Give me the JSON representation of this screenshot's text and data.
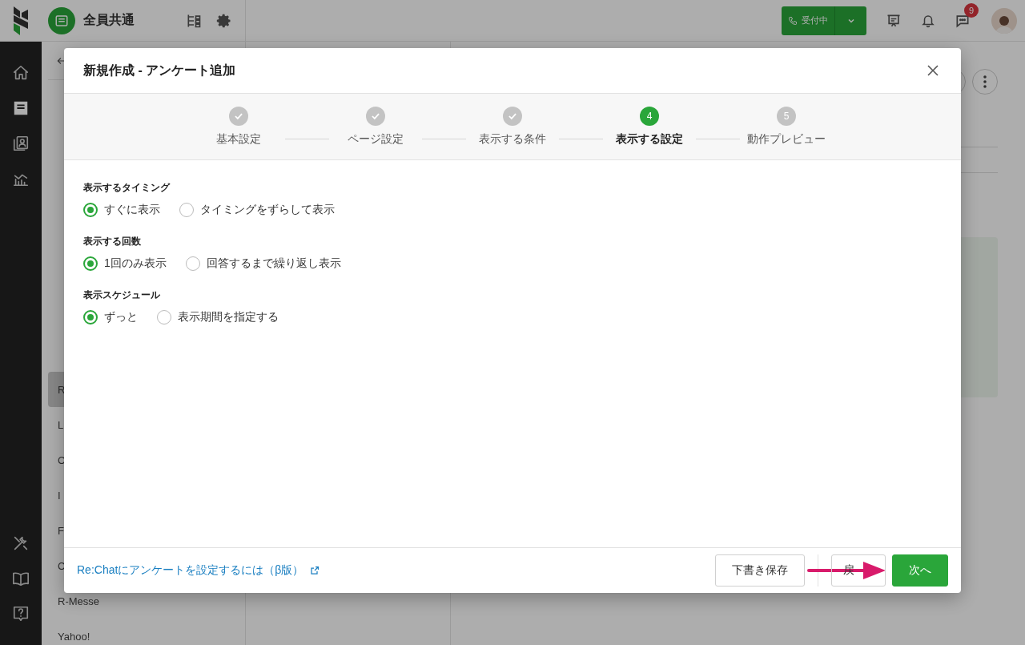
{
  "topbar": {
    "workspace": "全員共通",
    "status_button": "受付中",
    "notification_count": "9"
  },
  "sidebar": {
    "items": [
      {
        "label": "R",
        "selected": true
      },
      {
        "label": "L",
        "selected": false
      },
      {
        "label": "C",
        "selected": false
      },
      {
        "label": "I",
        "selected": false
      },
      {
        "label": "F",
        "selected": false
      },
      {
        "label": "C",
        "selected": false
      },
      {
        "label": "R-Messe",
        "selected": false
      },
      {
        "label": "Yahoo!",
        "selected": false
      }
    ]
  },
  "dialog": {
    "title": "新規作成 - アンケート追加",
    "steps": [
      {
        "label": "基本設定",
        "completed": true,
        "selected": false
      },
      {
        "label": "ページ設定",
        "completed": true,
        "selected": false
      },
      {
        "label": "表示する条件",
        "completed": true,
        "selected": false
      },
      {
        "label": "表示する設定",
        "completed": false,
        "selected": true,
        "number": "4"
      },
      {
        "label": "動作プレビュー",
        "completed": false,
        "selected": false,
        "number": "5"
      }
    ],
    "sections": [
      {
        "label": "表示するタイミング",
        "options": [
          {
            "label": "すぐに表示",
            "selected": true
          },
          {
            "label": "タイミングをずらして表示",
            "selected": false
          }
        ]
      },
      {
        "label": "表示する回数",
        "options": [
          {
            "label": "1回のみ表示",
            "selected": true
          },
          {
            "label": "回答するまで繰り返し表示",
            "selected": false
          }
        ]
      },
      {
        "label": "表示スケジュール",
        "options": [
          {
            "label": "ずっと",
            "selected": true
          },
          {
            "label": "表示期間を指定する",
            "selected": false
          }
        ]
      }
    ],
    "help_link": "Re:Chatにアンケートを設定するには（β版）",
    "buttons": [
      {
        "label": "下書き保存",
        "kind": "secondary"
      },
      {
        "label": "戻",
        "kind": "secondary"
      },
      {
        "label": "次へ",
        "kind": "primary"
      }
    ]
  }
}
